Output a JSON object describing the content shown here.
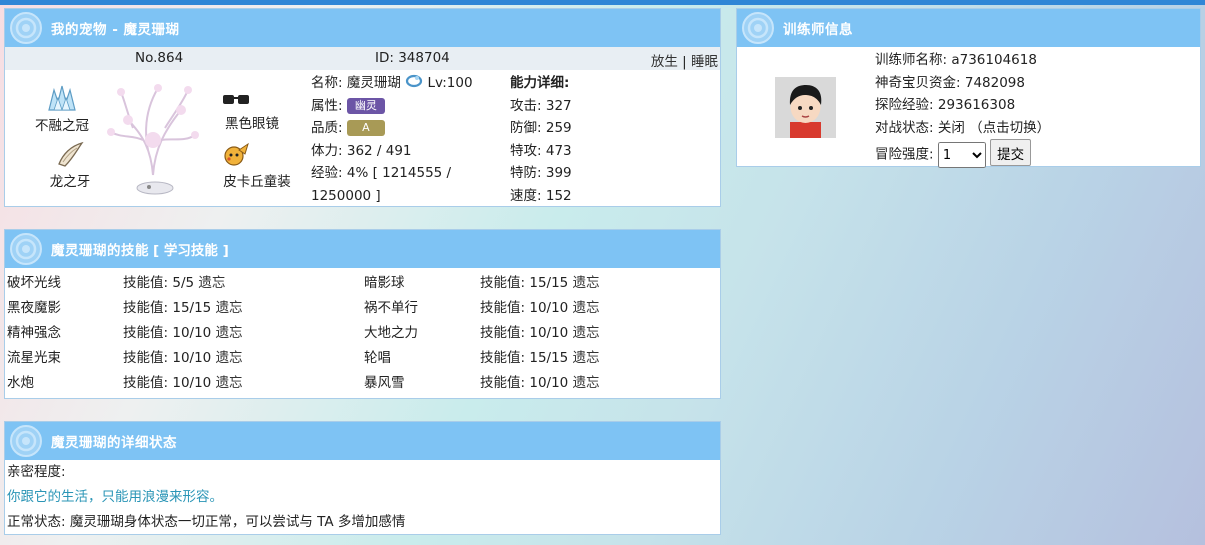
{
  "pet": {
    "header": "我的宠物 - 魔灵珊瑚",
    "number": "No.864",
    "id_text": "ID: 348704",
    "release_label": "放生",
    "separator": "|",
    "sleep_label": "睡眠",
    "items": [
      {
        "label": "不融之冠",
        "icon": "ice-crown-icon"
      },
      {
        "label": "龙之牙",
        "icon": "dragon-fang-icon"
      },
      {
        "label": "黑色眼镜",
        "icon": "black-glasses-icon"
      },
      {
        "label": "皮卡丘童装",
        "icon": "pikachu-costume-icon"
      }
    ],
    "name_label": "名称:",
    "name_value": "魔灵珊瑚",
    "level": "Lv:100",
    "attr_label": "属性:",
    "attr_value": "幽灵",
    "grade_label": "品质:",
    "grade_value": "A",
    "hp_label": "体力:",
    "hp_value": "362 / 491",
    "exp_label": "经验:",
    "exp_value": "4% [ 1214555 /",
    "exp_value2": "1250000 ]",
    "stats_title": "能力详细:",
    "stats": [
      {
        "label": "攻击:",
        "value": "327"
      },
      {
        "label": "防御:",
        "value": "259"
      },
      {
        "label": "特攻:",
        "value": "473"
      },
      {
        "label": "特防:",
        "value": "399"
      },
      {
        "label": "速度:",
        "value": "152"
      }
    ]
  },
  "trainer": {
    "header": "训练师信息",
    "name_label": "训练师名称:",
    "name_value": "a736104618",
    "funds_label": "神奇宝贝资金:",
    "funds_value": "7482098",
    "exp_label": "探险经验:",
    "exp_value": "293616308",
    "battle_label": "对战状态:",
    "battle_value": "关闭",
    "battle_toggle": "（点击切换）",
    "difficulty_label": "冒险强度:",
    "difficulty_value": "1",
    "submit_label": "提交"
  },
  "skills": {
    "header": "魔灵珊瑚的技能",
    "learn_open": "[",
    "learn_label": "学习技能",
    "learn_close": "]",
    "pp_label": "技能值:",
    "forget_label": "遗忘",
    "list": [
      {
        "name": "破坏光线",
        "pp": "5/5"
      },
      {
        "name": "暗影球",
        "pp": "15/15"
      },
      {
        "name": "黑夜魔影",
        "pp": "15/15"
      },
      {
        "name": "祸不单行",
        "pp": "10/10"
      },
      {
        "name": "精神强念",
        "pp": "10/10"
      },
      {
        "name": "大地之力",
        "pp": "10/10"
      },
      {
        "name": "流星光束",
        "pp": "10/10"
      },
      {
        "name": "轮唱",
        "pp": "15/15"
      },
      {
        "name": "水炮",
        "pp": "10/10"
      },
      {
        "name": "暴风雪",
        "pp": "10/10"
      }
    ]
  },
  "status": {
    "header": "魔灵珊瑚的详细状态",
    "intimacy_label": "亲密程度:",
    "intimacy_text": "你跟它的生活，只能用浪漫来形容。",
    "condition_text": "正常状态: 魔灵珊瑚身体状态一切正常，可以尝试与 TA 多增加感情"
  },
  "colors": {
    "header_bg": "#7ec3f4",
    "top_line": "#2f86d6",
    "attr_badge": "#6c55a6",
    "grade_badge": "#a89a56",
    "quote_text": "#2a95b6"
  }
}
